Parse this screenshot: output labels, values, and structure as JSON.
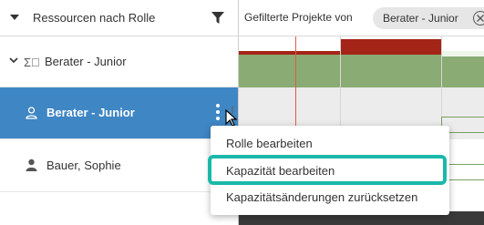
{
  "left_panel": {
    "header_title": "Ressourcen nach Rolle",
    "group_label": "Berater - Junior",
    "selected_label": "Berater - Junior",
    "person_label": "Bauer, Sophie"
  },
  "right_panel": {
    "filter_text": "Gefilterte Projekte von",
    "chip_label": "Berater - Junior"
  },
  "context_menu": {
    "items": [
      "Rolle bearbeiten",
      "Kapazität bearbeiten",
      "Kapazitätsänderungen zurücksetzen"
    ],
    "highlighted_index": 1
  },
  "colors": {
    "selected_row": "#3f86c4",
    "over_capacity": "#a52418",
    "capacity_green": "#8aac74",
    "highlight_outline": "#19b8a8"
  },
  "icons": [
    "caret-down-icon",
    "filter-icon",
    "chevron-down-icon",
    "sigma-icon",
    "user-outline-icon",
    "kebab-menu-icon",
    "user-icon",
    "close-icon",
    "cursor-icon",
    "resize-handle-icon"
  ]
}
